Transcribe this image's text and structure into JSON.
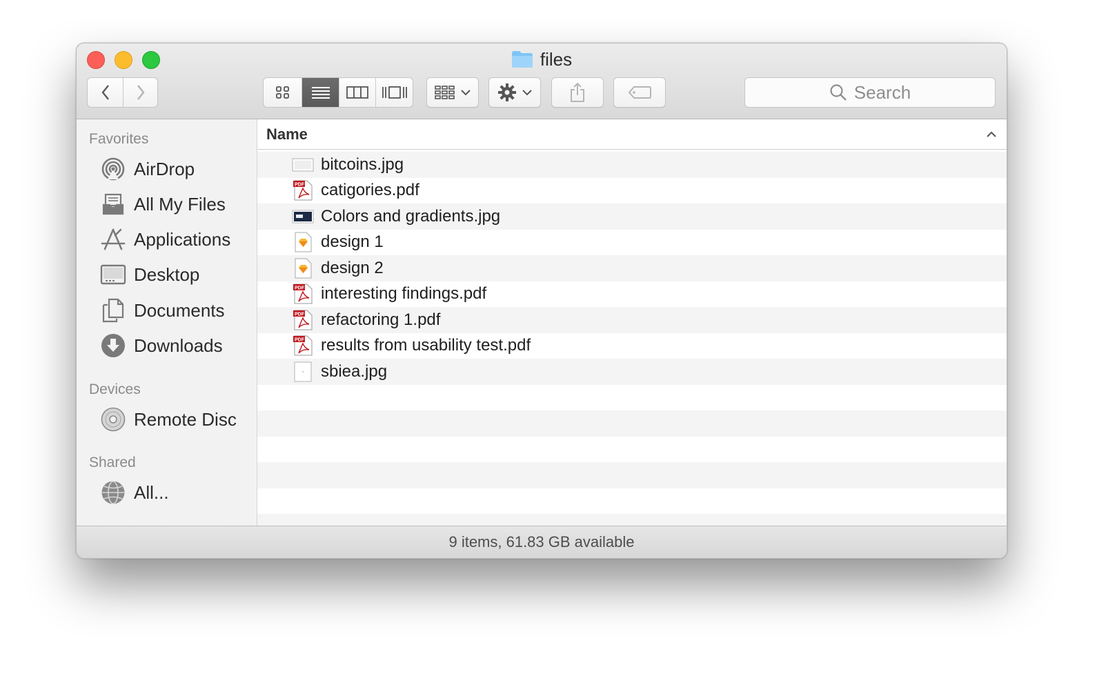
{
  "window": {
    "title": "files"
  },
  "toolbar": {
    "back": "back",
    "forward": "forward",
    "views": [
      "icon-view",
      "list-view",
      "column-view",
      "cover-flow-view"
    ],
    "active_view": "list-view",
    "search_placeholder": "Search"
  },
  "sidebar": {
    "favorites_label": "Favorites",
    "favorites": [
      {
        "label": "AirDrop",
        "icon": "airdrop-icon"
      },
      {
        "label": "All My Files",
        "icon": "all-my-files-icon"
      },
      {
        "label": "Applications",
        "icon": "applications-icon"
      },
      {
        "label": "Desktop",
        "icon": "desktop-icon"
      },
      {
        "label": "Documents",
        "icon": "documents-icon"
      },
      {
        "label": "Downloads",
        "icon": "downloads-icon"
      }
    ],
    "devices_label": "Devices",
    "devices": [
      {
        "label": "Remote Disc",
        "icon": "remote-disc-icon"
      }
    ],
    "shared_label": "Shared",
    "shared": [
      {
        "label": "All...",
        "icon": "network-icon"
      }
    ]
  },
  "list": {
    "column_name": "Name",
    "files": [
      {
        "name": "bitcoins.jpg",
        "type": "jpg-blank"
      },
      {
        "name": "catigories.pdf",
        "type": "pdf"
      },
      {
        "name": "Colors and gradients.jpg",
        "type": "jpg-dark"
      },
      {
        "name": "design 1",
        "type": "sketch"
      },
      {
        "name": "design 2",
        "type": "sketch"
      },
      {
        "name": "interesting findings.pdf",
        "type": "pdf"
      },
      {
        "name": "refactoring 1.pdf",
        "type": "pdf"
      },
      {
        "name": "results from usability test.pdf",
        "type": "pdf"
      },
      {
        "name": "sbiea.jpg",
        "type": "jpg-light"
      }
    ]
  },
  "status": {
    "text": "9 items, 61.83 GB available"
  },
  "colors": {
    "red": "#fc5f57",
    "yellow": "#fdbc2e",
    "green": "#2bc840",
    "folder": "#7fc4f5",
    "pdf_red": "#c0181f"
  }
}
